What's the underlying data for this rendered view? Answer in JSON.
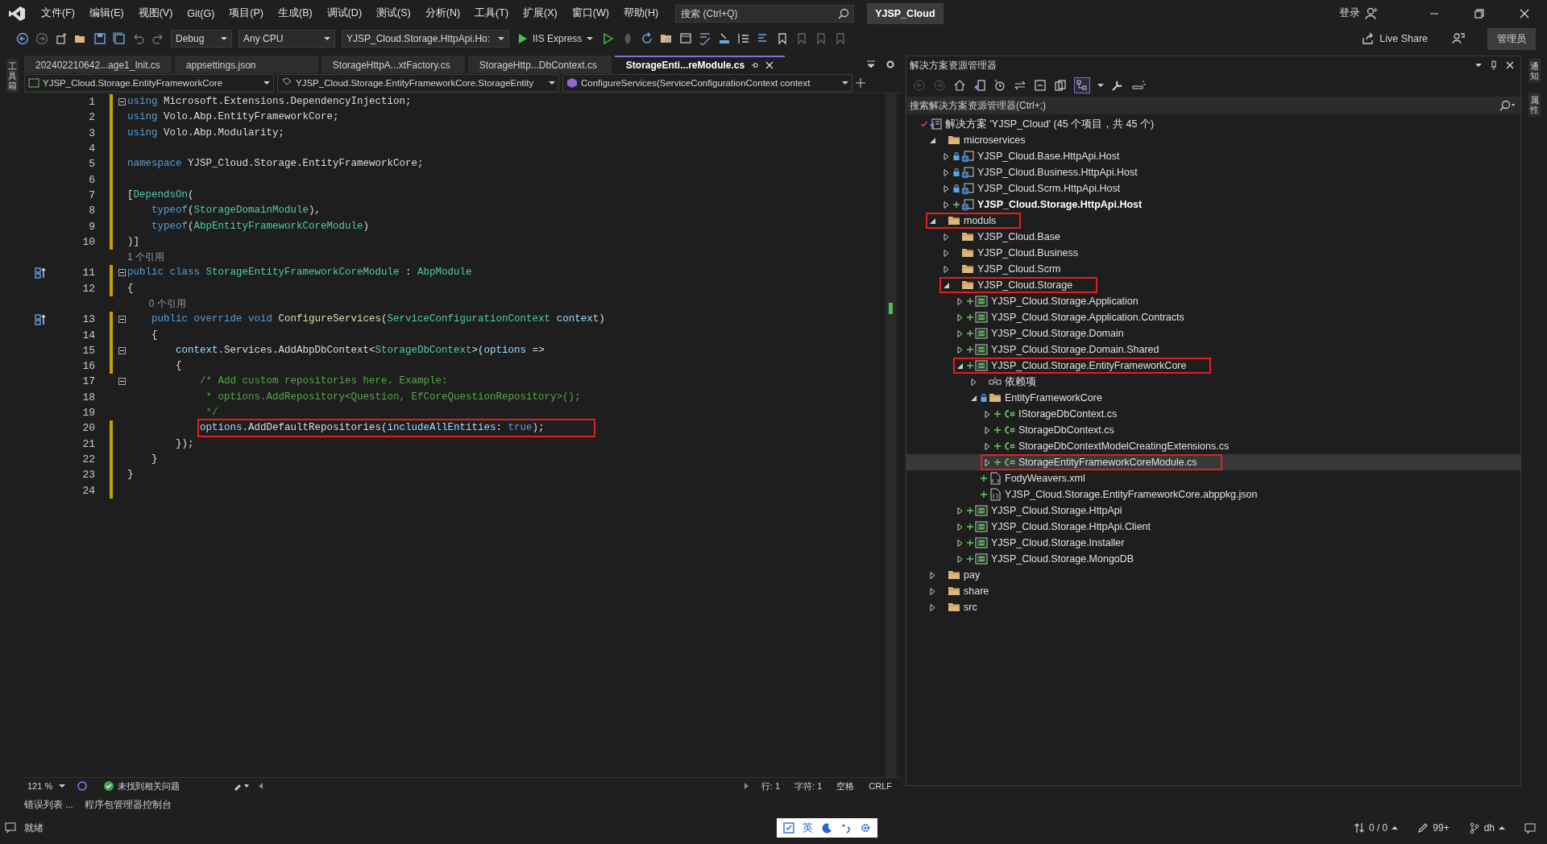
{
  "menu": [
    "文件(F)",
    "编辑(E)",
    "视图(V)",
    "Git(G)",
    "项目(P)",
    "生成(B)",
    "调试(D)",
    "测试(S)",
    "分析(N)",
    "工具(T)",
    "扩展(X)",
    "窗口(W)",
    "帮助(H)"
  ],
  "search": {
    "placeholder": "搜索 (Ctrl+Q)"
  },
  "solution_title": "YJSP_Cloud",
  "account": {
    "login": "登录"
  },
  "toolbar": {
    "configuration": "Debug",
    "platform": "Any CPU",
    "startup_project": "YJSP_Cloud.Storage.HttpApi.Ho:",
    "run": "IIS Express",
    "live_share": "Live Share",
    "admin": "管理员"
  },
  "left_strip": "工具箱",
  "right_strip": [
    "通知",
    "属性"
  ],
  "tabs": [
    {
      "label": "202402210642...age1_Init.cs",
      "selected": false
    },
    {
      "label": "appsettings.json",
      "selected": false
    },
    {
      "label": "StorageHttpA...xtFactory.cs",
      "selected": false
    },
    {
      "label": "StorageHttp...DbContext.cs",
      "selected": false
    },
    {
      "label": "StorageEnti...reModule.cs",
      "selected": true
    }
  ],
  "nav_bar": [
    "YJSP_Cloud.Storage.EntityFrameworkCore",
    "YJSP_Cloud.Storage.EntityFrameworkCore.StorageEntity",
    "ConfigureServices(ServiceConfigurationContext context"
  ],
  "code": [
    {
      "kind": "code",
      "number": "1",
      "fold": true,
      "changed": true,
      "tokens": [
        {
          "kind": "keyword",
          "text": "using"
        },
        {
          "kind": "plain",
          "text": " Microsoft.Extensions.DependencyInjection;"
        }
      ]
    },
    {
      "kind": "code",
      "number": "2",
      "changed": true,
      "tokens": [
        {
          "kind": "keyword",
          "text": "using"
        },
        {
          "kind": "plain",
          "text": " Volo.Abp.EntityFrameworkCore;"
        }
      ]
    },
    {
      "kind": "code",
      "number": "3",
      "changed": true,
      "tokens": [
        {
          "kind": "keyword",
          "text": "using"
        },
        {
          "kind": "plain",
          "text": " Volo.Abp.Modularity;"
        }
      ]
    },
    {
      "kind": "code",
      "number": "4",
      "changed": true
    },
    {
      "kind": "code",
      "number": "5",
      "changed": true,
      "tokens": [
        {
          "kind": "keyword",
          "text": "namespace"
        },
        {
          "kind": "plain",
          "text": " YJSP_Cloud.Storage.EntityFrameworkCore;"
        }
      ]
    },
    {
      "kind": "code",
      "number": "6",
      "changed": true
    },
    {
      "kind": "code",
      "number": "7",
      "changed": true,
      "tokens": [
        {
          "kind": "plain",
          "text": "["
        },
        {
          "kind": "type",
          "text": "DependsOn"
        },
        {
          "kind": "plain",
          "text": "("
        }
      ]
    },
    {
      "kind": "code",
      "number": "8",
      "changed": true,
      "tokens": [
        {
          "kind": "keyword",
          "text": "    typeof"
        },
        {
          "kind": "plain",
          "text": "("
        },
        {
          "kind": "type",
          "text": "StorageDomainModule"
        },
        {
          "kind": "plain",
          "text": "),"
        }
      ]
    },
    {
      "kind": "code",
      "number": "9",
      "changed": true,
      "tokens": [
        {
          "kind": "keyword",
          "text": "    typeof"
        },
        {
          "kind": "plain",
          "text": "("
        },
        {
          "kind": "type",
          "text": "AbpEntityFrameworkCoreModule"
        },
        {
          "kind": "plain",
          "text": ")"
        }
      ]
    },
    {
      "kind": "code",
      "number": "10",
      "changed": true,
      "tokens": [
        {
          "kind": "plain",
          "text": ")]"
        }
      ]
    },
    {
      "kind": "codelens",
      "text": "1 个引用"
    },
    {
      "kind": "code",
      "number": "11",
      "fold": true,
      "changed": true,
      "marker": true,
      "tokens": [
        {
          "kind": "keyword",
          "text": "public class "
        },
        {
          "kind": "type",
          "text": "StorageEntityFrameworkCoreModule"
        },
        {
          "kind": "plain",
          "text": " : "
        },
        {
          "kind": "type",
          "text": "AbpModule"
        }
      ]
    },
    {
      "kind": "code",
      "number": "12",
      "changed": true,
      "tokens": [
        {
          "kind": "plain",
          "text": "{"
        }
      ]
    },
    {
      "kind": "codelens",
      "text": "    0 个引用"
    },
    {
      "kind": "code",
      "number": "13",
      "fold": true,
      "changed": true,
      "marker": true,
      "tokens": [
        {
          "kind": "keyword",
          "text": "    public override void "
        },
        {
          "kind": "method",
          "text": "ConfigureServices"
        },
        {
          "kind": "plain",
          "text": "("
        },
        {
          "kind": "type",
          "text": "ServiceConfigurationContext"
        },
        {
          "kind": "param",
          "text": " context"
        },
        {
          "kind": "plain",
          "text": ")"
        }
      ]
    },
    {
      "kind": "code",
      "number": "14",
      "changed": true,
      "tokens": [
        {
          "kind": "plain",
          "text": "    {"
        }
      ]
    },
    {
      "kind": "code",
      "number": "15",
      "fold": true,
      "changed": true,
      "tokens": [
        {
          "kind": "param",
          "text": "        context"
        },
        {
          "kind": "plain",
          "text": ".Services.AddAbpDbContext<"
        },
        {
          "kind": "type",
          "text": "StorageDbContext"
        },
        {
          "kind": "plain",
          "text": ">("
        },
        {
          "kind": "param",
          "text": "options"
        },
        {
          "kind": "plain",
          "text": " =>"
        }
      ]
    },
    {
      "kind": "code",
      "number": "16",
      "changed": true,
      "tokens": [
        {
          "kind": "plain",
          "text": "        {"
        }
      ]
    },
    {
      "kind": "code",
      "number": "17",
      "fold": true,
      "changed": false,
      "tokens": [
        {
          "kind": "comment",
          "text": "            /* Add custom repositories here. Example:"
        }
      ]
    },
    {
      "kind": "code",
      "number": "18",
      "changed": false,
      "tokens": [
        {
          "kind": "comment",
          "text": "             * options.AddRepository<Question, EfCoreQuestionRepository>();"
        }
      ]
    },
    {
      "kind": "code",
      "number": "19",
      "changed": false,
      "tokens": [
        {
          "kind": "comment",
          "text": "             */"
        }
      ]
    },
    {
      "kind": "code",
      "number": "20",
      "changed": true,
      "highlight": true,
      "tokens": [
        {
          "kind": "param",
          "text": "            options"
        },
        {
          "kind": "plain",
          "text": ".AddDefaultRepositories("
        },
        {
          "kind": "param",
          "text": "includeAllEntities"
        },
        {
          "kind": "plain",
          "text": ": "
        },
        {
          "kind": "keyword",
          "text": "true"
        },
        {
          "kind": "plain",
          "text": ");"
        }
      ]
    },
    {
      "kind": "code",
      "number": "21",
      "changed": true,
      "tokens": [
        {
          "kind": "plain",
          "text": "        });"
        }
      ]
    },
    {
      "kind": "code",
      "number": "22",
      "changed": true,
      "tokens": [
        {
          "kind": "plain",
          "text": "    }"
        }
      ]
    },
    {
      "kind": "code",
      "number": "23",
      "changed": true,
      "tokens": [
        {
          "kind": "plain",
          "text": "}"
        }
      ]
    },
    {
      "kind": "code",
      "number": "24",
      "changed": true
    }
  ],
  "editor_status": {
    "zoom": "121 %",
    "issues": "未找到相关问题",
    "line": "行: 1",
    "char": "字符: 1",
    "indent": "空格",
    "eol": "CRLF"
  },
  "bottom_tabs": [
    "错误列表 ...",
    "程序包管理器控制台"
  ],
  "solution_explorer": {
    "title": "解决方案资源管理器",
    "search": {
      "placeholder": "搜索解决方案资源管理器(Ctrl+;)"
    },
    "tree": [
      {
        "label": "解决方案 'YJSP_Cloud' (45 个项目，共 45 个)",
        "kind": "solution",
        "selected": false,
        "children": [
          {
            "label": "microservices",
            "kind": "folder",
            "expanded": true,
            "selected": false,
            "children": [
              {
                "label": "YJSP_Cloud.Base.HttpApi.Host",
                "kind": "web",
                "locked": true,
                "expanded": false,
                "selected": false
              },
              {
                "label": "YJSP_Cloud.Business.HttpApi.Host",
                "kind": "web",
                "locked": true,
                "expanded": false,
                "selected": false
              },
              {
                "label": "YJSP_Cloud.Scrm.HttpApi.Host",
                "kind": "web",
                "locked": true,
                "expanded": false,
                "selected": false
              },
              {
                "label": "YJSP_Cloud.Storage.HttpApi.Host",
                "kind": "web",
                "added": true,
                "expanded": false,
                "selected": false,
                "startup": true
              }
            ]
          },
          {
            "label": "moduls",
            "kind": "folder",
            "expanded": true,
            "selected": false,
            "highlighted": true,
            "children": [
              {
                "label": "YJSP_Cloud.Base",
                "kind": "folder",
                "expanded": false,
                "selected": false
              },
              {
                "label": "YJSP_Cloud.Business",
                "kind": "folder",
                "expanded": false,
                "selected": false
              },
              {
                "label": "YJSP_Cloud.Scrm",
                "kind": "folder",
                "expanded": false,
                "selected": false
              },
              {
                "label": "YJSP_Cloud.Storage",
                "kind": "folder",
                "expanded": true,
                "selected": false,
                "highlighted": true,
                "children": [
                  {
                    "label": "YJSP_Cloud.Storage.Application",
                    "kind": "project",
                    "added": true,
                    "expanded": false,
                    "selected": false
                  },
                  {
                    "label": "YJSP_Cloud.Storage.Application.Contracts",
                    "kind": "project",
                    "added": true,
                    "expanded": false,
                    "selected": false
                  },
                  {
                    "label": "YJSP_Cloud.Storage.Domain",
                    "kind": "project",
                    "added": true,
                    "expanded": false,
                    "selected": false
                  },
                  {
                    "label": "YJSP_Cloud.Storage.Domain.Shared",
                    "kind": "project",
                    "added": true,
                    "expanded": false,
                    "selected": false
                  },
                  {
                    "label": "YJSP_Cloud.Storage.EntityFrameworkCore",
                    "kind": "project",
                    "added": true,
                    "expanded": true,
                    "selected": false,
                    "highlighted": true,
                    "children": [
                      {
                        "label": "依赖项",
                        "kind": "dependencies",
                        "expanded": false,
                        "selected": false
                      },
                      {
                        "label": "EntityFrameworkCore",
                        "kind": "folder",
                        "locked": true,
                        "expanded": true,
                        "selected": false,
                        "children": [
                          {
                            "label": "IStorageDbContext.cs",
                            "kind": "source",
                            "added": true,
                            "expanded": false,
                            "selected": false
                          },
                          {
                            "label": "StorageDbContext.cs",
                            "kind": "source",
                            "added": true,
                            "expanded": false,
                            "selected": false
                          },
                          {
                            "label": "StorageDbContextModelCreatingExtensions.cs",
                            "kind": "source",
                            "added": true,
                            "expanded": false,
                            "selected": false
                          },
                          {
                            "label": "StorageEntityFrameworkCoreModule.cs",
                            "kind": "source",
                            "added": true,
                            "expanded": false,
                            "selected": true,
                            "highlighted": true
                          }
                        ]
                      },
                      {
                        "label": "FodyWeavers.xml",
                        "kind": "markup",
                        "added": true,
                        "selected": false
                      },
                      {
                        "label": "YJSP_Cloud.Storage.EntityFrameworkCore.abppkg.json",
                        "kind": "data",
                        "added": true,
                        "selected": false
                      }
                    ]
                  },
                  {
                    "label": "YJSP_Cloud.Storage.HttpApi",
                    "kind": "project",
                    "added": true,
                    "expanded": false,
                    "selected": false
                  },
                  {
                    "label": "YJSP_Cloud.Storage.HttpApi.Client",
                    "kind": "project",
                    "added": true,
                    "expanded": false,
                    "selected": false
                  },
                  {
                    "label": "YJSP_Cloud.Storage.Installer",
                    "kind": "project",
                    "added": true,
                    "expanded": false,
                    "selected": false
                  },
                  {
                    "label": "YJSP_Cloud.Storage.MongoDB",
                    "kind": "project",
                    "added": true,
                    "expanded": false,
                    "selected": false
                  }
                ]
              }
            ]
          },
          {
            "label": "pay",
            "kind": "folder",
            "expanded": false,
            "selected": false
          },
          {
            "label": "share",
            "kind": "folder",
            "expanded": false,
            "selected": false
          },
          {
            "label": "src",
            "kind": "folder",
            "expanded": false,
            "selected": false
          }
        ]
      }
    ]
  },
  "status_bar": {
    "state": "就绪",
    "ime": "英",
    "git_changes": "0 / 0",
    "edits": "99+",
    "branch": "dh"
  }
}
